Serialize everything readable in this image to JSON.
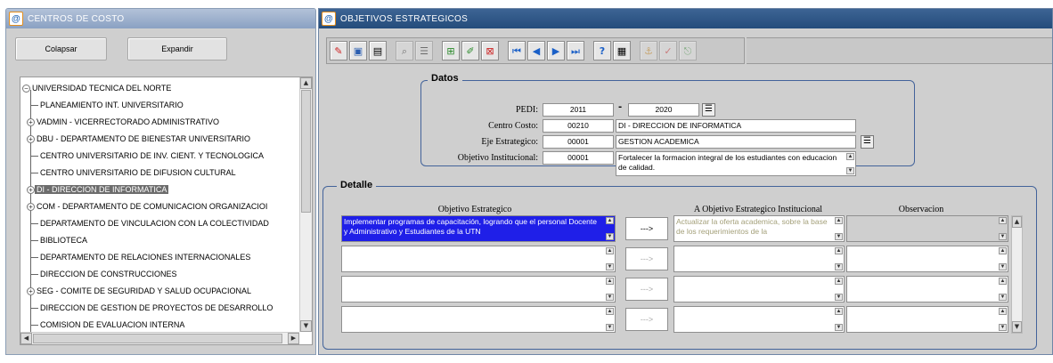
{
  "left_window": {
    "title": "CENTROS DE COSTO",
    "collapse_label": "Colapsar",
    "expand_label": "Expandir",
    "tree": [
      {
        "label": "UNIVERSIDAD TECNICA DEL NORTE",
        "level": 0,
        "expander": "minus"
      },
      {
        "label": "PLANEAMIENTO INT. UNIVERSITARIO",
        "level": 1,
        "expander": "none"
      },
      {
        "label": "VADMIN - VICERRECTORADO ADMINISTRATIVO",
        "level": 1,
        "expander": "plus"
      },
      {
        "label": "DBU - DEPARTAMENTO DE BIENESTAR UNIVERSITARIO",
        "level": 1,
        "expander": "plus"
      },
      {
        "label": "CENTRO UNIVERSITARIO DE INV. CIENT. Y TECNOLOGICA",
        "level": 1,
        "expander": "none"
      },
      {
        "label": "CENTRO UNIVERSITARIO DE DIFUSION CULTURAL",
        "level": 1,
        "expander": "none"
      },
      {
        "label": "DI - DIRECCION DE INFORMATICA",
        "level": 1,
        "expander": "plus",
        "selected": true
      },
      {
        "label": "COM - DEPARTAMENTO DE COMUNICACION ORGANIZACIOI",
        "level": 1,
        "expander": "plus"
      },
      {
        "label": "DEPARTAMENTO DE VINCULACION CON LA COLECTIVIDAD",
        "level": 1,
        "expander": "none"
      },
      {
        "label": "BIBLIOTECA",
        "level": 1,
        "expander": "none"
      },
      {
        "label": "DEPARTAMENTO DE RELACIONES INTERNACIONALES",
        "level": 1,
        "expander": "none"
      },
      {
        "label": "DIRECCION DE CONSTRUCCIONES",
        "level": 1,
        "expander": "none"
      },
      {
        "label": "SEG - COMITE DE SEGURIDAD Y SALUD OCUPACIONAL",
        "level": 1,
        "expander": "plus"
      },
      {
        "label": "DIRECCION DE GESTION DE PROYECTOS DE DESARROLLO",
        "level": 1,
        "expander": "none"
      },
      {
        "label": "COMISION DE EVALUACION INTERNA",
        "level": 1,
        "expander": "none"
      }
    ]
  },
  "right_window": {
    "title": "OBJETIVOS ESTRATEGICOS",
    "toolbar_icons": [
      "save-icon",
      "disk-icon",
      "print-icon",
      "enter-query-icon",
      "execute-query-icon",
      "insert-record-icon",
      "edit-record-icon",
      "delete-record-icon",
      "first-record-icon",
      "previous-record-icon",
      "next-record-icon",
      "last-record-icon",
      "help-icon",
      "calculator-icon",
      "anchor-icon",
      "check-icon",
      "exit-icon"
    ],
    "datos": {
      "title": "Datos",
      "pedi_label": "PEDI:",
      "pedi_from": "2011",
      "pedi_sep": "-",
      "pedi_to": "2020",
      "centro_label": "Centro Costo:",
      "centro_code": "00210",
      "centro_name": "DI - DIRECCION DE INFORMATICA",
      "eje_label": "Eje Estrategico:",
      "eje_code": "00001",
      "eje_name": "GESTION ACADEMICA",
      "obj_label": "Objetivo Institucional:",
      "obj_code": "00001",
      "obj_text": "Fortalecer la formacion integral de los estudiantes con educacion de calidad."
    },
    "detalle": {
      "title": "Detalle",
      "col_objetivo": "Objetivo Estrategico",
      "col_a_objetivo": "A Objetivo Estrategico Institucional",
      "col_observacion": "Observacion",
      "rows": [
        {
          "objetivo": "Implementar programas de capacitación, logrando que el personal Docente y Administrativo y Estudiantes de la UTN",
          "button": "--->",
          "a_objetivo": "Actualizar la oferta academica, sobre la base de los requerimientos de la",
          "observacion": ""
        },
        {
          "objetivo": "",
          "button": "--->",
          "a_objetivo": "",
          "observacion": ""
        },
        {
          "objetivo": "",
          "button": "--->",
          "a_objetivo": "",
          "observacion": ""
        },
        {
          "objetivo": "",
          "button": "--->",
          "a_objetivo": "",
          "observacion": ""
        }
      ]
    }
  }
}
